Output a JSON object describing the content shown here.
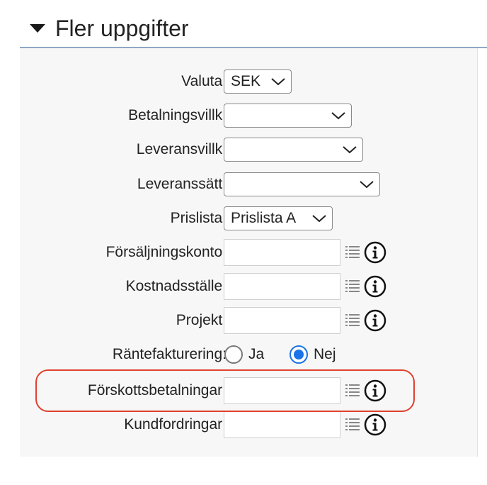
{
  "section": {
    "title": "Fler uppgifter"
  },
  "fields": {
    "valuta": {
      "label": "Valuta:",
      "value": "SEK"
    },
    "betalningsvillkor": {
      "label": "Betalningsvillk:",
      "value": ""
    },
    "leveransvillkor": {
      "label": "Leveransvillk:",
      "value": ""
    },
    "leveranssatt": {
      "label": "Leveranssätt:",
      "value": ""
    },
    "prislista": {
      "label": "Prislista:",
      "value": "Prislista A"
    },
    "forsaljningskonto": {
      "label": "Försäljningskonto:",
      "value": ""
    },
    "kostnadsstalle": {
      "label": "Kostnadsställe:",
      "value": ""
    },
    "projekt": {
      "label": "Projekt:",
      "value": ""
    },
    "rantefakturering": {
      "label": "Räntefakturering:",
      "options": [
        {
          "label": "Ja",
          "selected": false
        },
        {
          "label": "Nej",
          "selected": true
        }
      ]
    },
    "forskottsbetalningar": {
      "label": "Förskottsbetalningar:",
      "value": ""
    },
    "kundfordringar": {
      "label": "Kundfordringar:",
      "value": ""
    }
  },
  "icons": {
    "lookup": "list-icon",
    "info": "info-icon",
    "collapse": "caret-down-icon"
  },
  "colors": {
    "highlight": "#e0412e",
    "radio_selected": "#1a73e8",
    "header_rule": "#8fa7c4"
  }
}
